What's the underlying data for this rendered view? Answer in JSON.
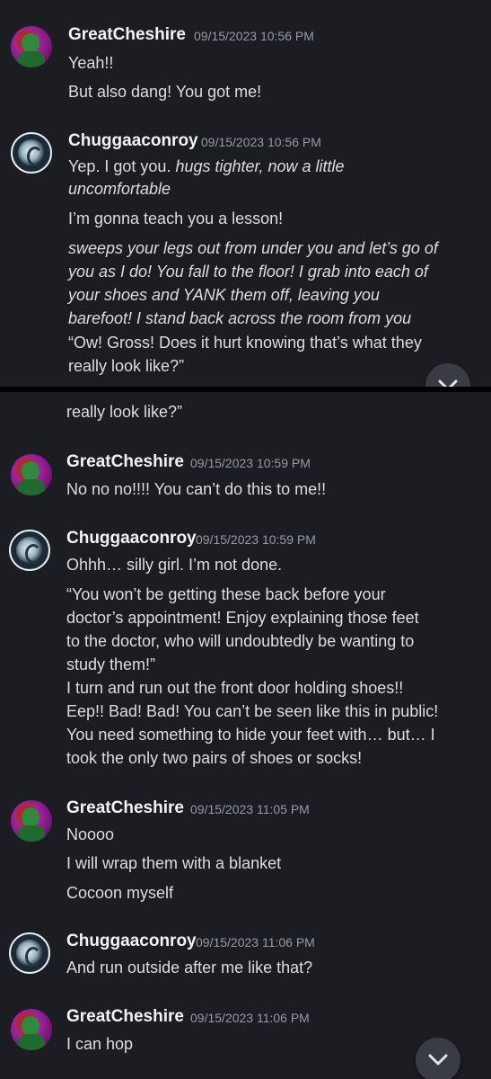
{
  "top": {
    "messages": [
      {
        "author": "GreatCheshire",
        "time": "09/15/2023 10:56 PM",
        "lines": [
          "Yeah!!",
          "But also dang! You got me!"
        ]
      },
      {
        "author": "Chuggaaconroy",
        "time": "09/15/2023 10:56 PM",
        "line1_plain": "Yep. I got you. ",
        "line1_italic": "hugs tighter, now a little",
        "line2_italic": "uncomfortable",
        "line3": "I’m gonna teach you a lesson!",
        "italic_block": [
          "sweeps your legs out from under you and let’s go of",
          "you as I do! You fall to the floor! I grab into each of",
          "your shoes and YANK them off, leaving you",
          "barefoot! I stand back across the room from you"
        ],
        "quote_lines": [
          "“Ow! Gross! Does it hurt knowing that’s what they",
          "really look like?”"
        ]
      }
    ]
  },
  "bottom": {
    "cut_line": "really look like?”",
    "messages": [
      {
        "author": "GreatCheshire",
        "time": "09/15/2023 10:59 PM",
        "lines": [
          "No no no!!!! You can’t do this to me!!"
        ]
      },
      {
        "author": "Chuggaaconroy",
        "time": "09/15/2023 10:59 PM",
        "lines": [
          "Ohhh… silly girl. I’m not done.",
          "“You won’t be getting these back before your",
          "doctor’s appointment! Enjoy explaining those feet",
          "to the doctor, who will undoubtedly be wanting to",
          "study them!”",
          "I turn and run out the front door holding shoes!!",
          "Eep!! Bad! Bad! You can’t be seen like this in public!",
          "You need something to hide your feet with… but… I",
          "took the only two pairs of shoes or socks!"
        ]
      },
      {
        "author": "GreatCheshire",
        "time": "09/15/2023 11:05 PM",
        "lines": [
          "Noooo",
          "I will wrap them with a blanket",
          "Cocoon myself"
        ]
      },
      {
        "author": "Chuggaaconroy",
        "time": "09/15/2023 11:06 PM",
        "lines": [
          "And run outside after me like that?"
        ]
      },
      {
        "author": "GreatCheshire",
        "time": "09/15/2023 11:06 PM",
        "lines": [
          "I can hop"
        ]
      }
    ]
  },
  "icons": {
    "scroll_down": "chevron-down-icon"
  }
}
